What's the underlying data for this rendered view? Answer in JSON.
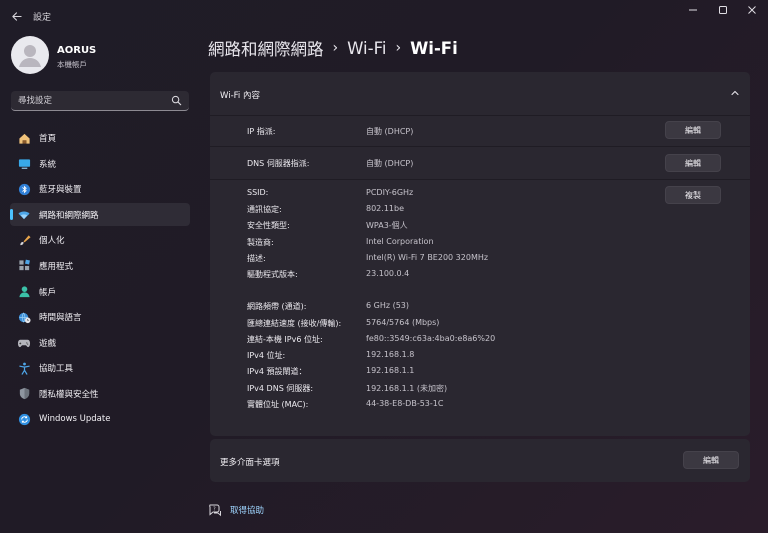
{
  "titlebar": {
    "app_title": "設定"
  },
  "profile": {
    "name": "AORUS",
    "subtitle": "本機帳戶"
  },
  "search": {
    "placeholder": "尋找設定"
  },
  "sidebar": {
    "items": [
      {
        "label": "首頁",
        "icon": "home-icon"
      },
      {
        "label": "系統",
        "icon": "system-icon"
      },
      {
        "label": "藍牙與裝置",
        "icon": "bluetooth-icon"
      },
      {
        "label": "網路和網際網路",
        "icon": "network-icon",
        "active": true
      },
      {
        "label": "個人化",
        "icon": "brush-icon"
      },
      {
        "label": "應用程式",
        "icon": "apps-icon"
      },
      {
        "label": "帳戶",
        "icon": "account-icon"
      },
      {
        "label": "時間與語言",
        "icon": "globe-clock-icon"
      },
      {
        "label": "遊戲",
        "icon": "gamepad-icon"
      },
      {
        "label": "協助工具",
        "icon": "accessibility-icon"
      },
      {
        "label": "隱私權與安全性",
        "icon": "shield-icon"
      },
      {
        "label": "Windows Update",
        "icon": "windows-update-icon"
      }
    ]
  },
  "breadcrumb": {
    "part1": "網路和網際網路",
    "part2": "Wi-Fi",
    "current": "Wi-Fi"
  },
  "panel": {
    "title": "Wi-Fi 內容",
    "ip": {
      "label": "IP 指派:",
      "value": "自動 (DHCP)",
      "button": "編輯"
    },
    "dns": {
      "label": "DNS 伺服器指派:",
      "value": "自動 (DHCP)",
      "button": "編輯"
    },
    "copy_button": "複製",
    "details": [
      {
        "label": "SSID:",
        "value": "PCDIY-6GHz"
      },
      {
        "label": "通訊協定:",
        "value": "802.11be"
      },
      {
        "label": "安全性類型:",
        "value": "WPA3-個人"
      },
      {
        "label": "製造商:",
        "value": "Intel Corporation"
      },
      {
        "label": "描述:",
        "value": "Intel(R) Wi-Fi 7 BE200 320MHz"
      },
      {
        "label": "驅動程式版本:",
        "value": "23.100.0.4"
      }
    ],
    "details2": [
      {
        "label": "網路頻帶 (通道):",
        "value": "6 GHz (53)"
      },
      {
        "label": "匯總連結速度 (接收/傳輸):",
        "value": "5764/5764 (Mbps)"
      },
      {
        "label": "連結-本機 IPv6 位址:",
        "value": "fe80::3549:c63a:4ba0:e8a6%20"
      },
      {
        "label": "IPv4 位址:",
        "value": "192.168.1.8"
      },
      {
        "label": "IPv4 預設閘道：",
        "value": "192.168.1.1"
      },
      {
        "label": "IPv4 DNS 伺服器:",
        "value": "192.168.1.1 (未加密)"
      },
      {
        "label": "實體位址 (MAC):",
        "value": "44-38-E8-DB-53-1C"
      }
    ]
  },
  "more_adapter": {
    "label": "更多介面卡選項",
    "button": "編輯"
  },
  "help": {
    "label": "取得協助"
  },
  "colors": {
    "accent": "#4cc2ff",
    "panel": "#2a2730",
    "link": "#9fd5ff"
  }
}
